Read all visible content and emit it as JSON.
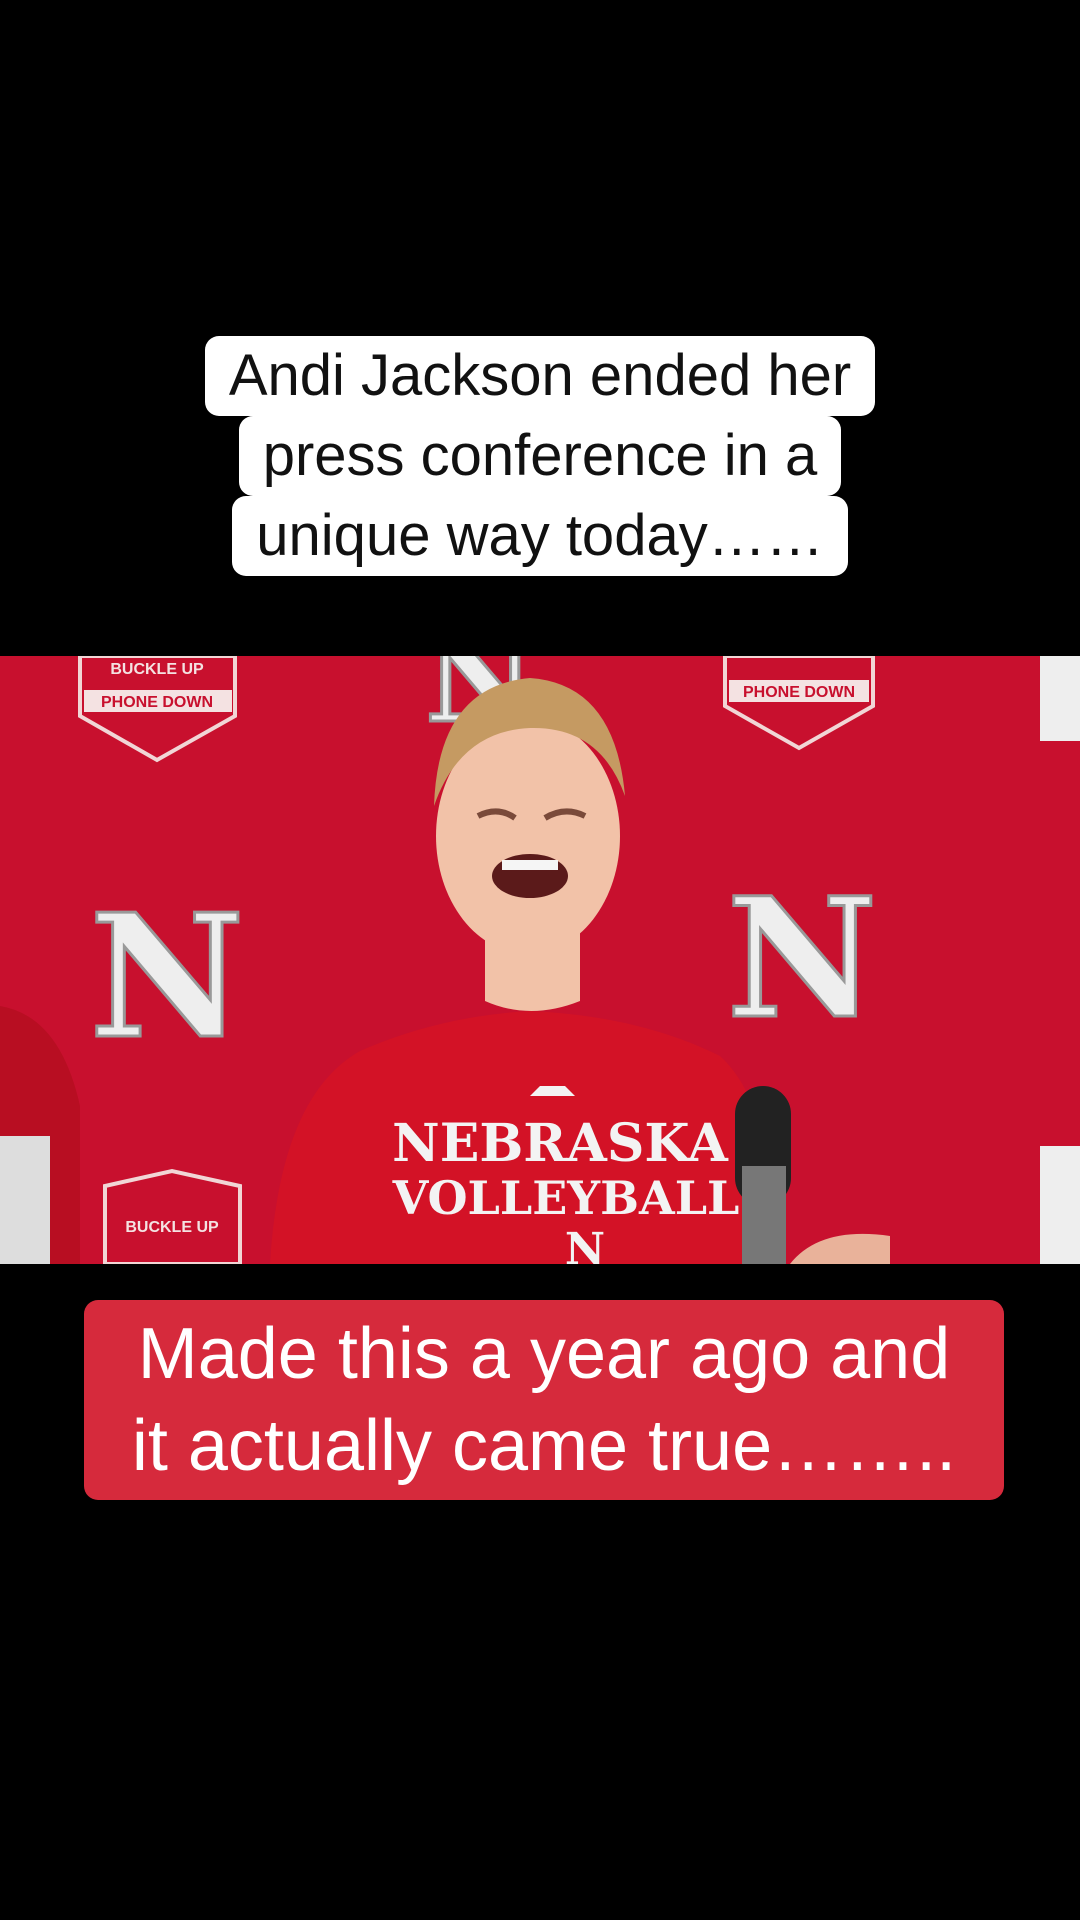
{
  "top_caption": {
    "line1": "Andi Jackson ended her",
    "line2": "press conference in a",
    "line3": "unique way today……"
  },
  "video": {
    "badge_line1": "BUCKLE UP",
    "badge_line2": "PHONE DOWN",
    "logo_letter": "N",
    "shirt_line1": "NEBRASKA",
    "shirt_line2": "VOLLEYBALL",
    "shirt_letter": "N",
    "colors": {
      "backdrop": "#c8102e",
      "shirt": "#d31226",
      "skin": "#f2c2a8",
      "hair": "#c59a62"
    }
  },
  "bottom_caption": {
    "line1": "Made this a year ago and",
    "line2": "it actually came true……..",
    "background": "#d62a3c"
  }
}
